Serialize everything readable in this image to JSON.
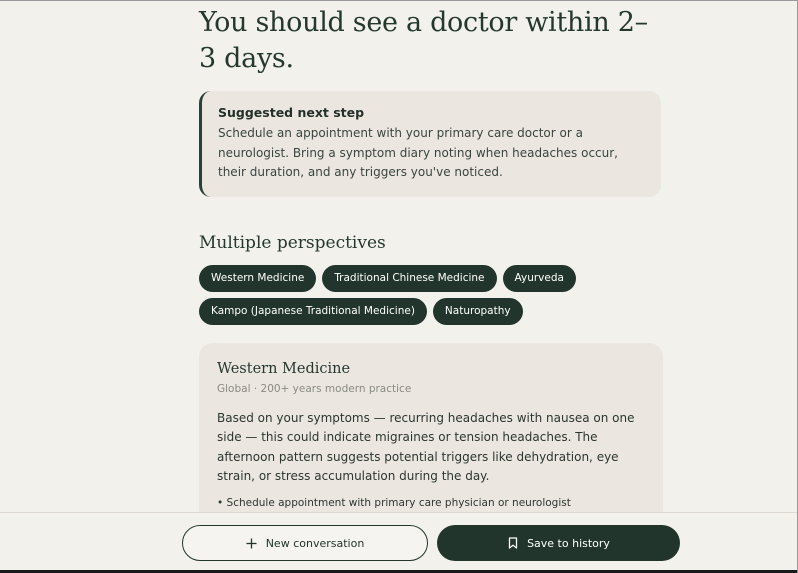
{
  "headline": "You should see a doctor within 2–3 days.",
  "next_step": {
    "title": "Suggested next step",
    "body": "Schedule an appointment with your primary care doctor or a neurologist. Bring a symptom diary noting when headaches occur, their duration, and any triggers you've noticed."
  },
  "perspectives": {
    "title": "Multiple perspectives",
    "chips": [
      "Western Medicine",
      "Traditional Chinese Medicine",
      "Ayurveda",
      "Kampo (Japanese Traditional Medicine)",
      "Naturopathy"
    ]
  },
  "card": {
    "title": "Western Medicine",
    "subtitle": "Global · 200+ years modern practice",
    "body": "Based on your symptoms — recurring headaches with nausea on one side — this could indicate migraines or tension headaches. The afternoon pattern suggests potential triggers like dehydration, eye strain, or stress accumulation during the day.",
    "bullet": "• Schedule appointment with primary care physician or neurologist"
  },
  "actions": {
    "new_conversation": "New conversation",
    "save_history": "Save to history"
  },
  "icons": {
    "new_conversation": "plus-icon",
    "save_history": "bookmark-icon"
  },
  "colors": {
    "background": "#f3f1ec",
    "accent": "#22352c",
    "card": "#ebe7e0"
  }
}
